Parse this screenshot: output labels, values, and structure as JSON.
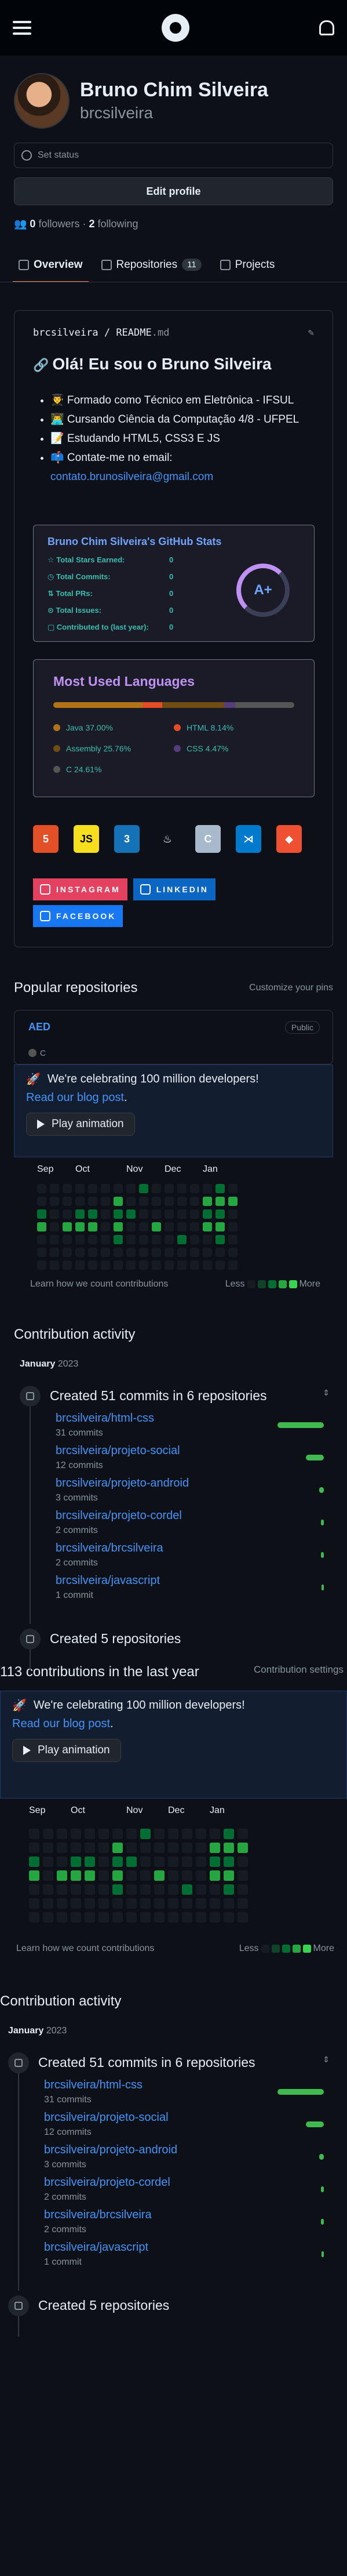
{
  "user": {
    "name": "Bruno Chim Silveira",
    "login": "brcsilveira",
    "set_status": "Set status",
    "edit_profile": "Edit profile",
    "followers": "0",
    "followers_label": "followers",
    "following": "2",
    "following_label": "following"
  },
  "tabs": [
    {
      "label": "Overview"
    },
    {
      "label": "Repositories",
      "count": "11"
    },
    {
      "label": "Projects"
    }
  ],
  "readme": {
    "path_user": "brcsilveira",
    "path_sep": " / ",
    "path_file": "README",
    "path_ext": ".md",
    "title": "Olá! Eu sou o Bruno Silveira",
    "items": [
      "👨‍🎓 Formado como Técnico em Eletrônica - IFSUL",
      "👨‍💻 Cursando Ciência da Computação 4/8 - UFPEL",
      "📝 Estudando HTML5, CSS3 E JS",
      "📫 Contate-me no email:"
    ],
    "email": "contato.brunosilveira@gmail.com"
  },
  "stats": {
    "title": "Bruno Chim Silveira's GitHub Stats",
    "rows": [
      {
        "label": "Total Stars Earned:",
        "value": "0"
      },
      {
        "label": "Total Commits:",
        "value": "0"
      },
      {
        "label": "Total PRs:",
        "value": "0"
      },
      {
        "label": "Total Issues:",
        "value": "0"
      },
      {
        "label": "Contributed to (last year):",
        "value": "0"
      }
    ],
    "grade": "A+"
  },
  "languages": {
    "title": "Most Used Languages",
    "items": [
      {
        "name": "Java 37.00%",
        "color": "#b07219",
        "pct": 37.0
      },
      {
        "name": "HTML 8.14%",
        "color": "#e34c26",
        "pct": 8.14
      },
      {
        "name": "Assembly 25.76%",
        "color": "#6e4c13",
        "pct": 25.76
      },
      {
        "name": "CSS 4.47%",
        "color": "#563d7c",
        "pct": 4.47
      },
      {
        "name": "C 24.61%",
        "color": "#555555",
        "pct": 24.61
      }
    ]
  },
  "techs": [
    {
      "label": "5",
      "color": "#e34f26",
      "icon": "html5-icon"
    },
    {
      "label": "JS",
      "color": "#f7df1e",
      "icon": "javascript-icon"
    },
    {
      "label": "3",
      "color": "#1572b6",
      "icon": "css3-icon"
    },
    {
      "label": "♨",
      "color": "#0d1117",
      "icon": "java-icon"
    },
    {
      "label": "C",
      "color": "#a8b9cc",
      "icon": "c-icon"
    },
    {
      "label": "⋊",
      "color": "#007acc",
      "icon": "vscode-icon"
    },
    {
      "label": "◆",
      "color": "#f05032",
      "icon": "git-icon"
    }
  ],
  "social": [
    {
      "label": "INSTAGRAM",
      "color": "#e4405f"
    },
    {
      "label": "LINKEDIN",
      "color": "#0a66c2"
    },
    {
      "label": "FACEBOOK",
      "color": "#1877f2"
    }
  ],
  "popular": {
    "title": "Popular repositories",
    "customize": "Customize your pins",
    "repo_name": "AED",
    "visibility": "Public",
    "lang": "C"
  },
  "promo": {
    "title": "We're celebrating 100 million developers!",
    "link": "Read our blog post",
    "play": "Play animation"
  },
  "graph": {
    "months": [
      "Sep",
      "Oct",
      "Nov",
      "Dec",
      "Jan"
    ],
    "learn": "Learn how we count contributions",
    "less": "Less",
    "more": "More"
  },
  "contrib_summary": {
    "text": "113 contributions in the last year",
    "settings": "Contribution settings"
  },
  "activity": {
    "title": "Contribution activity",
    "month": "January",
    "year": "2023",
    "event1": "Created 51 commits in 6 repositories",
    "event2": "Created 5 repositories",
    "repos": [
      {
        "name": "brcsilveira/html-css",
        "commits": "31 commits",
        "n": 31
      },
      {
        "name": "brcsilveira/projeto-social",
        "commits": "12 commits",
        "n": 12
      },
      {
        "name": "brcsilveira/projeto-android",
        "commits": "3 commits",
        "n": 3
      },
      {
        "name": "brcsilveira/projeto-cordel",
        "commits": "2 commits",
        "n": 2
      },
      {
        "name": "brcsilveira/brcsilveira",
        "commits": "2 commits",
        "n": 2
      },
      {
        "name": "brcsilveira/javascript",
        "commits": "1 commit",
        "n": 1
      }
    ]
  }
}
